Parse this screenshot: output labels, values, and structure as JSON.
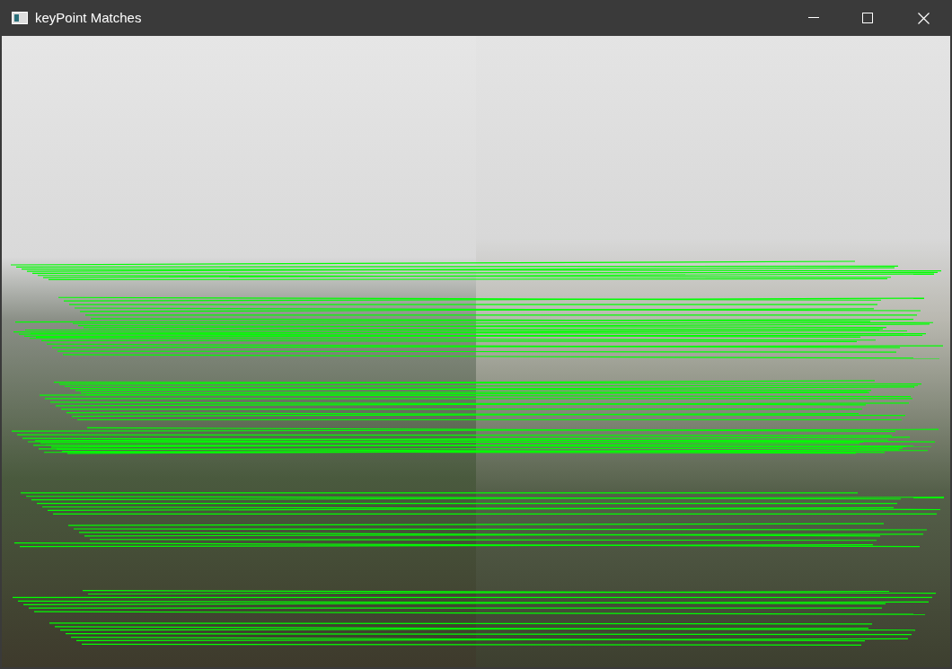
{
  "window": {
    "title": "keyPoint Matches"
  }
}
